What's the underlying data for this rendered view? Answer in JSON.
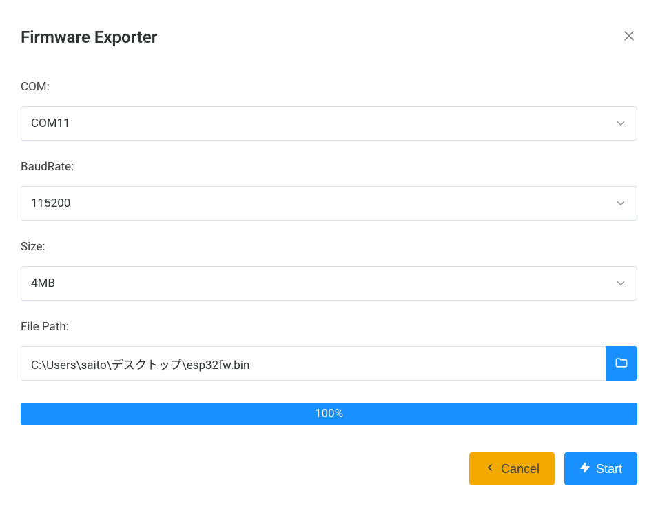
{
  "dialog": {
    "title": "Firmware Exporter"
  },
  "form": {
    "com": {
      "label": "COM:",
      "value": "COM11"
    },
    "baudrate": {
      "label": "BaudRate:",
      "value": "115200"
    },
    "size": {
      "label": "Size:",
      "value": "4MB"
    },
    "filepath": {
      "label": "File Path:",
      "value": "C:\\Users\\saito\\デスクトップ\\esp32fw.bin"
    }
  },
  "progress": {
    "text": "100%"
  },
  "buttons": {
    "cancel": "Cancel",
    "start": "Start"
  }
}
